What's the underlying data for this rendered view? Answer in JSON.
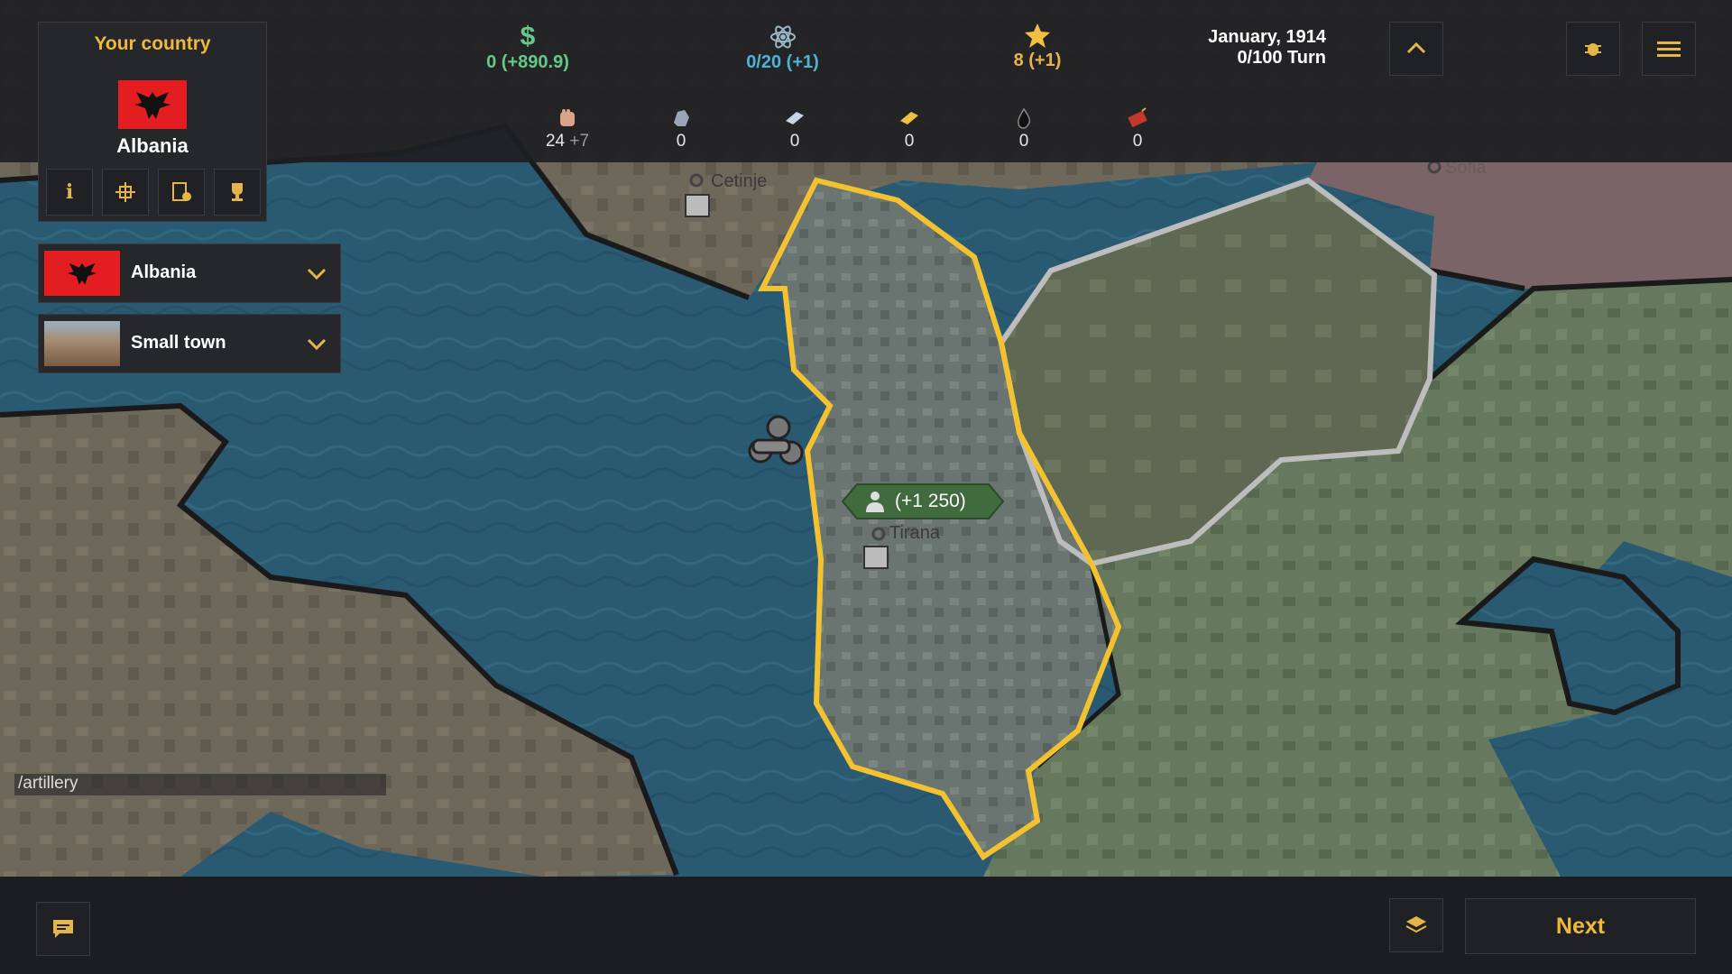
{
  "topbar": {
    "money": {
      "value": "0 (+890.9)",
      "color": "#66c98a",
      "icon": "dollar-icon"
    },
    "research": {
      "value": "0/20 (+1)",
      "color": "#4cb3d4",
      "icon": "atom-icon"
    },
    "prestige": {
      "value": "8 (+1)",
      "color": "#e6b54a",
      "icon": "star-icon"
    },
    "date": {
      "line1": "January, 1914",
      "line2": "0/100 Turn"
    }
  },
  "resources": [
    {
      "icon": "manpower-fist-icon",
      "value": "24",
      "increment": "+7"
    },
    {
      "icon": "ore-icon",
      "value": "0",
      "increment": ""
    },
    {
      "icon": "steel-icon",
      "value": "0",
      "increment": ""
    },
    {
      "icon": "gold-icon",
      "value": "0",
      "increment": ""
    },
    {
      "icon": "oil-drop-icon",
      "value": "0",
      "increment": ""
    },
    {
      "icon": "dynamite-icon",
      "value": "0",
      "increment": ""
    }
  ],
  "country_panel": {
    "title": "Your country",
    "name": "Albania",
    "buttons": [
      "info-icon",
      "technology-icon",
      "contract-icon",
      "trophy-icon"
    ]
  },
  "dropdowns": {
    "country": {
      "label": "Albania"
    },
    "region": {
      "label": "Small town"
    }
  },
  "map": {
    "cities": [
      {
        "name": "Cetinje"
      },
      {
        "name": "Tirana"
      },
      {
        "name": "Sofia"
      }
    ],
    "population_badge": "(+1 250)"
  },
  "console_text": "/artillery",
  "bottom": {
    "next_label": "Next"
  },
  "colors": {
    "accent": "#f0b83c",
    "selected_border": "#f2c230",
    "sea": "#2a5870",
    "panel": "#25272b"
  }
}
